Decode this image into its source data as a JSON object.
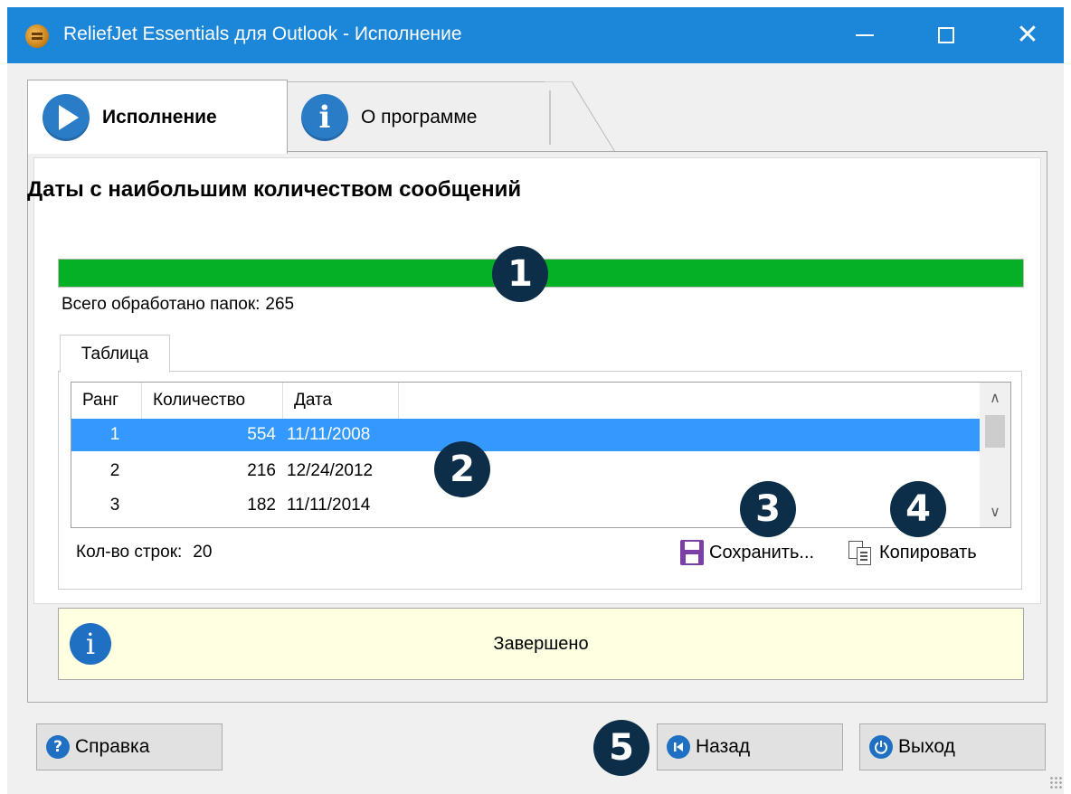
{
  "window": {
    "title": "ReliefJet Essentials для Outlook - Исполнение",
    "minimize_label": "—",
    "close_label": "✕"
  },
  "tabs": [
    {
      "label": "Исполнение",
      "icon": "play-icon",
      "active": true
    },
    {
      "label": "О программе",
      "icon": "info-icon",
      "active": false
    }
  ],
  "main": {
    "heading": "Даты с наибольшим количеством сообщений",
    "progress_percent": 100,
    "processed_label": "Всего обработано папок:",
    "processed_value": "265"
  },
  "subtab": {
    "label": "Таблица"
  },
  "table": {
    "columns": [
      "Ранг",
      "Количество",
      "Дата"
    ],
    "rows": [
      {
        "rank": "1",
        "count": "554",
        "date": "11/11/2008",
        "selected": true
      },
      {
        "rank": "2",
        "count": "216",
        "date": "12/24/2012",
        "selected": false
      },
      {
        "rank": "3",
        "count": "182",
        "date": "11/11/2014",
        "selected": false
      }
    ],
    "row_count_label": "Кол-во строк:",
    "row_count_value": "20"
  },
  "actions": {
    "save_label": "Сохранить...",
    "copy_label": "Копировать"
  },
  "status": {
    "text": "Завершено",
    "icon": "info-icon"
  },
  "buttons": {
    "help": "Справка",
    "back": "Назад",
    "exit": "Выход"
  },
  "badges": [
    "1",
    "2",
    "3",
    "4",
    "5"
  ],
  "colors": {
    "titlebar": "#1c86d8",
    "progress": "#06b025",
    "selection": "#3399ff",
    "status_bg": "#ffffe1",
    "badge": "#0d2e48"
  }
}
